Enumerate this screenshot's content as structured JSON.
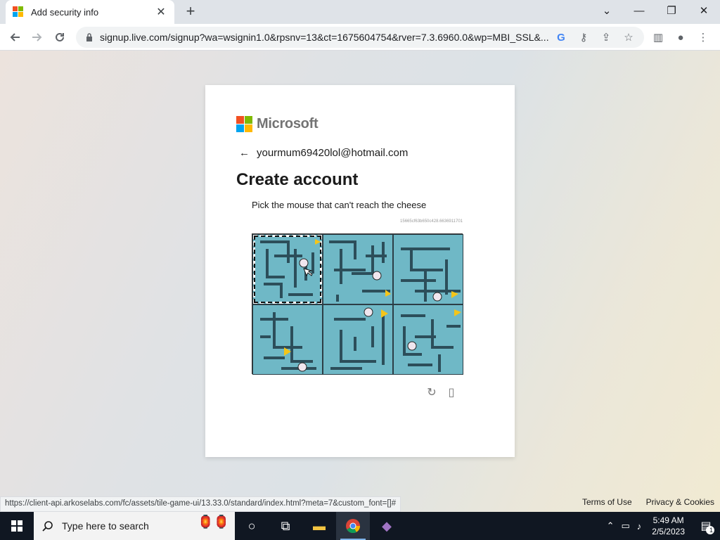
{
  "browser": {
    "tab_title": "Add security info",
    "new_tab": "+",
    "url": "signup.live.com/signup?wa=wsignin1.0&rpsnv=13&ct=1675604754&rver=7.3.6960.0&wp=MBI_SSL&...",
    "status_url": "https://client-api.arkoselabs.com/fc/assets/tile-game-ui/13.33.0/standard/index.html?meta=7&custom_font=[]#"
  },
  "card": {
    "brand": "Microsoft",
    "email": "yourmum69420lol@hotmail.com",
    "title": "Create account"
  },
  "captcha": {
    "prompt": "Pick the mouse that can't reach the cheese",
    "session_id": "15665cf63b650c428.6636911701",
    "tiles": [
      {
        "label": "tile-1",
        "selected": true
      },
      {
        "label": "tile-2",
        "selected": false
      },
      {
        "label": "tile-3",
        "selected": false
      },
      {
        "label": "tile-4",
        "selected": false
      },
      {
        "label": "tile-5",
        "selected": false
      },
      {
        "label": "tile-6",
        "selected": false
      }
    ]
  },
  "footer": {
    "terms": "Terms of Use",
    "privacy": "Privacy & Cookies"
  },
  "taskbar": {
    "search_placeholder": "Type here to search",
    "time": "5:49 AM",
    "date": "2/5/2023",
    "notification_count": "1"
  },
  "colors": {
    "ms_red": "#f25022",
    "ms_green": "#7fba00",
    "ms_blue": "#00a4ef",
    "ms_yellow": "#ffb900",
    "maze_bg": "#6fb8c6",
    "maze_wall": "#2c4e5a"
  },
  "icons": {
    "back": "arrow-left-icon",
    "forward": "arrow-right-icon",
    "reload": "reload-icon",
    "lock": "lock-icon",
    "refresh_captcha": "refresh-icon",
    "audio_captcha": "audio-icon"
  }
}
